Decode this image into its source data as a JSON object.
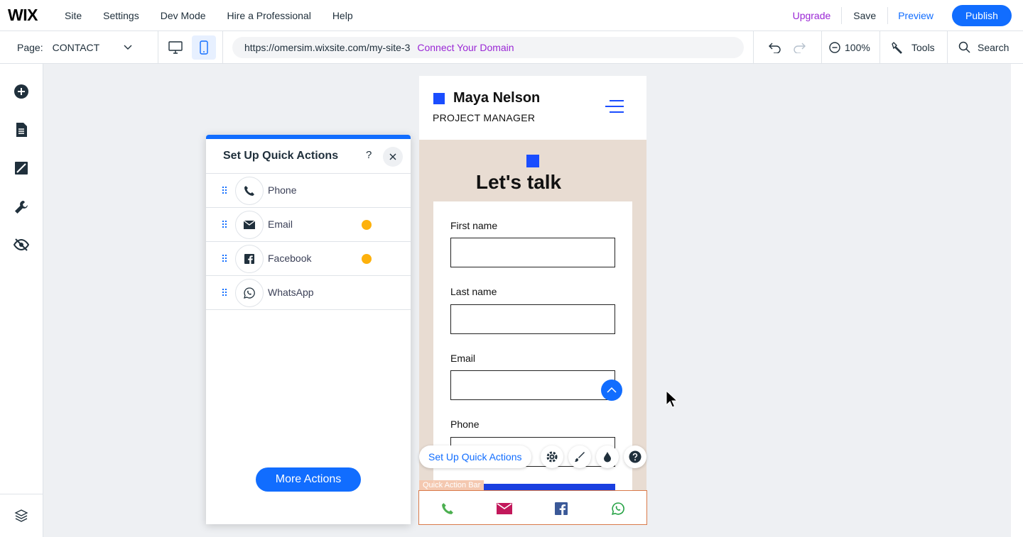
{
  "topbar": {
    "logo": "WIX",
    "menu": [
      "Site",
      "Settings",
      "Dev Mode",
      "Hire a Professional",
      "Help"
    ],
    "upgrade": "Upgrade",
    "save": "Save",
    "preview": "Preview",
    "publish": "Publish"
  },
  "toolbar": {
    "page_label": "Page:",
    "page_value": "CONTACT",
    "url": "https://omersim.wixsite.com/my-site-3",
    "connect_domain": "Connect Your Domain",
    "zoom": "100%",
    "tools": "Tools",
    "search": "Search"
  },
  "panel": {
    "title": "Set Up Quick Actions",
    "help": "?",
    "items": [
      {
        "label": "Phone",
        "icon": "phone-icon",
        "warning": false
      },
      {
        "label": "Email",
        "icon": "email-icon",
        "warning": true
      },
      {
        "label": "Facebook",
        "icon": "facebook-icon",
        "warning": true
      },
      {
        "label": "WhatsApp",
        "icon": "whatsapp-icon",
        "warning": false
      }
    ],
    "more_actions": "More Actions"
  },
  "site": {
    "name": "Maya Nelson",
    "role": "PROJECT MANAGER",
    "heading": "Let's talk",
    "fields": [
      "First name",
      "Last name",
      "Email",
      "Phone"
    ]
  },
  "floating": {
    "setup_button": "Set Up Quick Actions",
    "bar_tag": "Quick Action Bar"
  },
  "colors": {
    "accent": "#116dff",
    "upgrade": "#9a27d5",
    "site_blue": "#1a4dff",
    "site_bg": "#e8dcd2",
    "phone_green": "#4caf50",
    "email_pink": "#c2185b",
    "facebook_blue": "#3b5998",
    "whatsapp_green": "#25a244",
    "warning": "#fdb10c"
  }
}
